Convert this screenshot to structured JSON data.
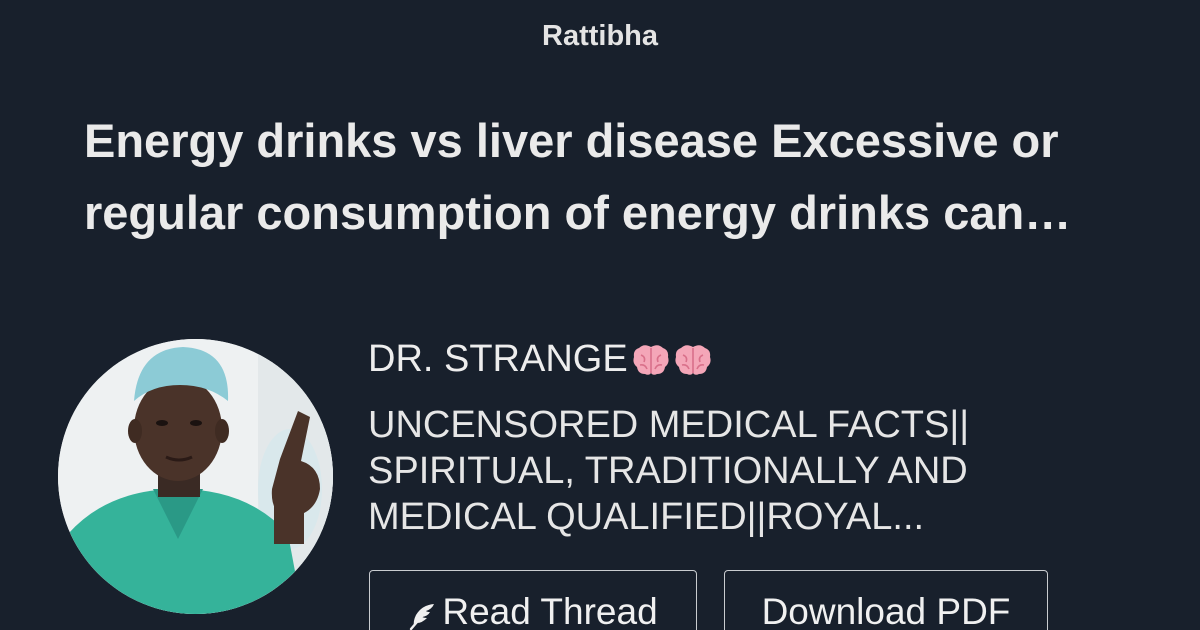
{
  "site": {
    "brand": "Rattibha"
  },
  "thread": {
    "title": "Energy drinks vs liver disease Excessive or regular consumption of energy drinks can contribute to liver disease"
  },
  "author": {
    "name": "DR. STRANGE",
    "bio": "UNCENSORED MEDICAL FACTS|| SPIRITUAL, TRADITIONALLY AND MEDICAL QUALIFIED||ROYAL...",
    "avatar_icon": "profile-photo"
  },
  "actions": {
    "read_label": "Read Thread",
    "read_icon": "feather-icon",
    "pdf_label": "Download PDF"
  },
  "colors": {
    "background": "#18202c",
    "text": "#ececec",
    "button_border": "#c9ccd0"
  }
}
